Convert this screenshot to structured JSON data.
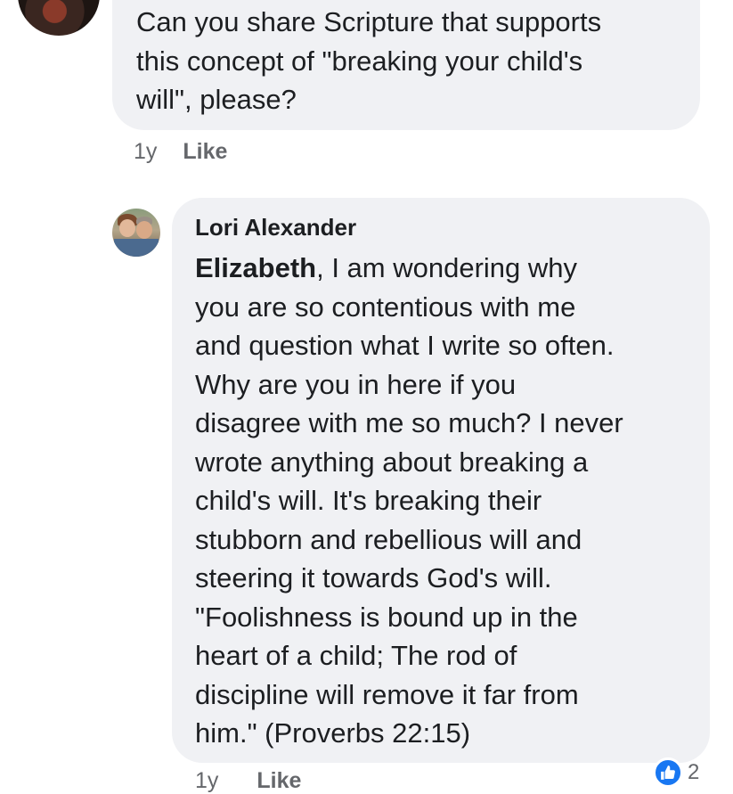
{
  "comments": [
    {
      "text": "Can you share Scripture that supports\nthis concept of \"breaking your child's\nwill\", please?",
      "age": "1y",
      "like_label": "Like"
    },
    {
      "author": "Lori Alexander",
      "mention": "Elizabeth",
      "text": ", I am wondering why\nyou are so contentious with me\nand question what I write so often.\nWhy are you in here if you\ndisagree with me so much? I never\nwrote anything about breaking a\nchild's will. It's breaking their\nstubborn and rebellious will and\nsteering it towards God's will.\n\"Foolishness is bound up in the\nheart of a child; The rod of\ndiscipline will remove it far from\nhim.\" (Proverbs 22:15)",
      "age": "1y",
      "like_label": "Like",
      "reaction_icon": "like-thumb-icon",
      "reaction_count": "2"
    }
  ],
  "colors": {
    "bubble": "#f0f1f4",
    "meta_text": "#65676b",
    "like_blue": "#1877f2"
  }
}
